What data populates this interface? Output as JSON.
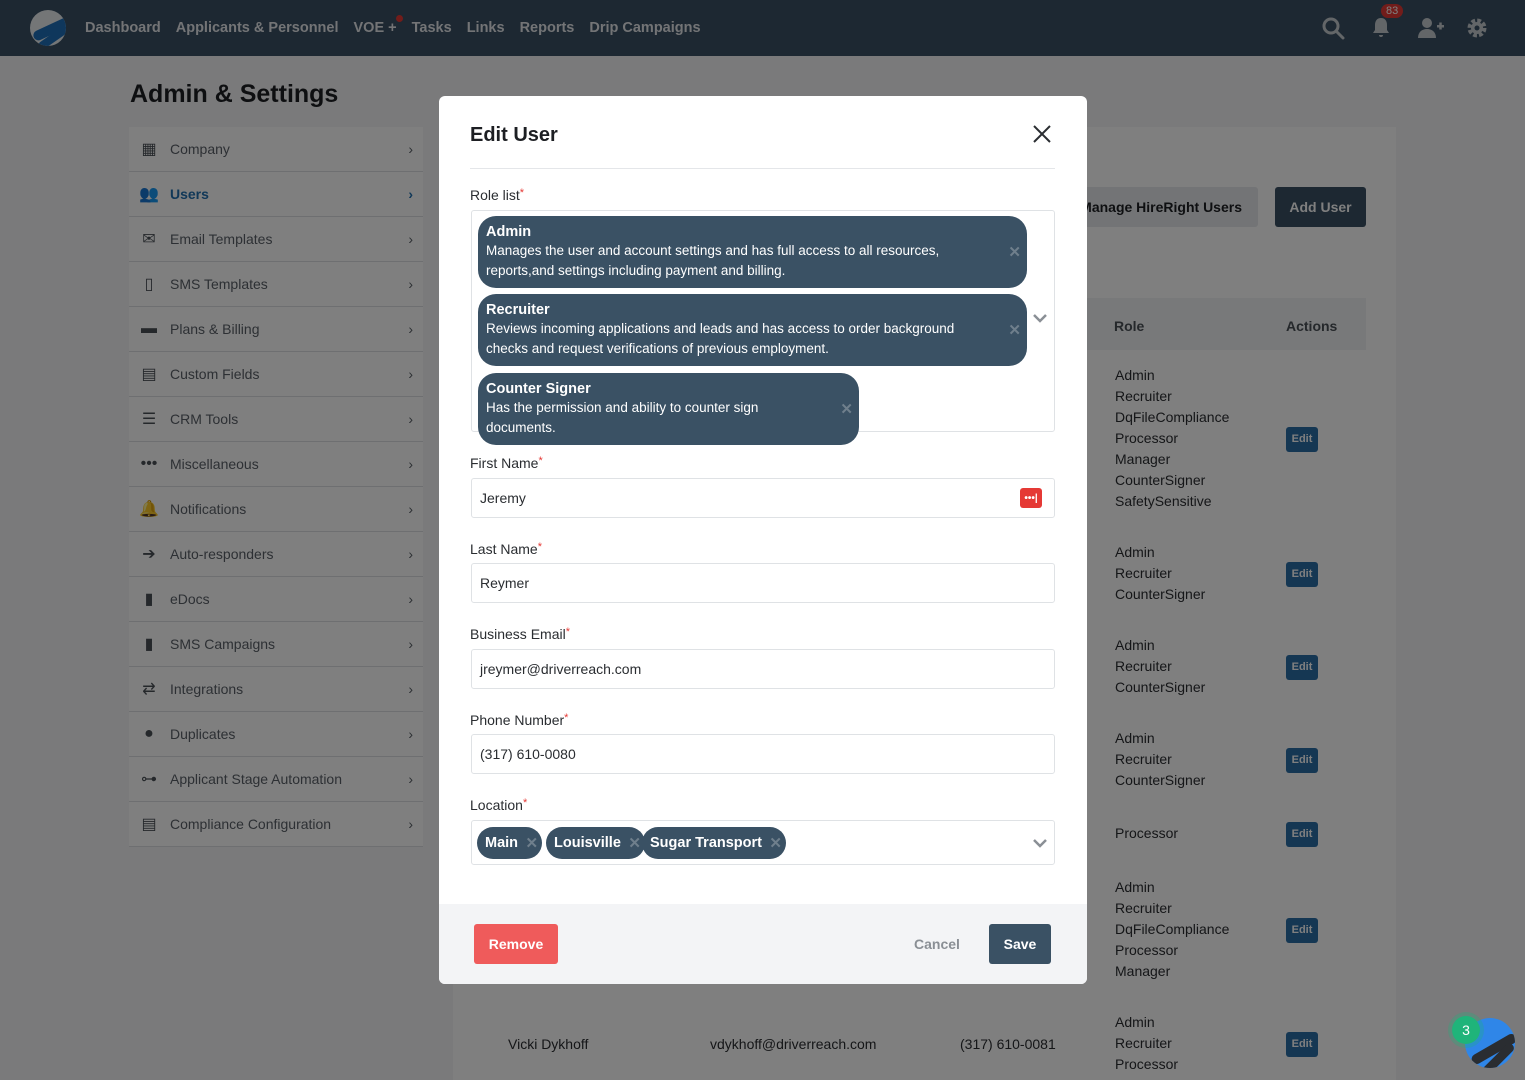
{
  "nav": {
    "links": [
      "Dashboard",
      "Applicants & Personnel",
      "VOE +",
      "Tasks",
      "Links",
      "Reports",
      "Drip Campaigns"
    ],
    "notification_count": "83",
    "icons": [
      "search-icon",
      "bell-icon",
      "add-user-icon",
      "gear-icon"
    ]
  },
  "page": {
    "title": "Admin & Settings"
  },
  "sidebar": {
    "items": [
      {
        "label": "Company",
        "icon": "building-icon",
        "glyph": "▦"
      },
      {
        "label": "Users",
        "icon": "users-icon",
        "glyph": "👥",
        "active": true
      },
      {
        "label": "Email Templates",
        "icon": "envelope-icon",
        "glyph": "✉"
      },
      {
        "label": "SMS Templates",
        "icon": "mobile-icon",
        "glyph": "▯"
      },
      {
        "label": "Plans & Billing",
        "icon": "credit-card-icon",
        "glyph": "▬"
      },
      {
        "label": "Custom Fields",
        "icon": "id-card-icon",
        "glyph": "▤"
      },
      {
        "label": "CRM Tools",
        "icon": "server-icon",
        "glyph": "☰"
      },
      {
        "label": "Miscellaneous",
        "icon": "ellipsis-icon",
        "glyph": "•••"
      },
      {
        "label": "Notifications",
        "icon": "bell-icon",
        "glyph": "🔔"
      },
      {
        "label": "Auto-responders",
        "icon": "arrow-circle-right-icon",
        "glyph": "➔"
      },
      {
        "label": "eDocs",
        "icon": "file-icon",
        "glyph": "▮"
      },
      {
        "label": "SMS Campaigns",
        "icon": "mobile-solid-icon",
        "glyph": "▮"
      },
      {
        "label": "Integrations",
        "icon": "exchange-icon",
        "glyph": "⇄"
      },
      {
        "label": "Duplicates",
        "icon": "user-icon",
        "glyph": "●"
      },
      {
        "label": "Applicant Stage Automation",
        "icon": "sitemap-icon",
        "glyph": "⊶"
      },
      {
        "label": "Compliance Configuration",
        "icon": "clipboard-list-icon",
        "glyph": "▤"
      }
    ]
  },
  "content": {
    "manage_hireright_label": "Manage HireRight Users",
    "add_user_label": "Add User",
    "columns": {
      "role": "Role",
      "actions": "Actions"
    },
    "edit_label": "Edit",
    "rows": [
      {
        "roles": [
          "Admin",
          "Recruiter",
          "DqFileCompliance",
          "Processor",
          "Manager",
          "CounterSigner",
          "SafetySensitive"
        ]
      },
      {
        "roles": [
          "Admin",
          "Recruiter",
          "CounterSigner"
        ]
      },
      {
        "roles": [
          "Admin",
          "Recruiter",
          "CounterSigner"
        ]
      },
      {
        "roles": [
          "Admin",
          "Recruiter",
          "CounterSigner"
        ]
      },
      {
        "roles": [
          "Processor"
        ]
      },
      {
        "roles": [
          "Admin",
          "Recruiter",
          "DqFileCompliance",
          "Processor",
          "Manager"
        ]
      },
      {
        "name": "Vicki Dykhoff",
        "email": "vdykhoff@driverreach.com",
        "phone": "(317) 610-0081",
        "roles": [
          "Admin",
          "Recruiter",
          "Processor"
        ]
      }
    ]
  },
  "modal": {
    "title": "Edit User",
    "role_list_label": "Role list",
    "roles": [
      {
        "name": "Admin",
        "description": "Manages the user and account settings and has full access to all resources, reports,and settings including payment and billing."
      },
      {
        "name": "Recruiter",
        "description": "Reviews incoming applications and leads and has access to order background checks and request verifications of previous employment."
      },
      {
        "name": "Counter Signer",
        "description": "Has the permission and ability to counter sign documents."
      }
    ],
    "first_name_label": "First Name",
    "first_name_value": "Jeremy",
    "last_name_label": "Last Name",
    "last_name_value": "Reymer",
    "email_label": "Business Email",
    "email_value": "jreymer@driverreach.com",
    "phone_label": "Phone Number",
    "phone_value": "(317) 610-0080",
    "location_label": "Location",
    "locations": [
      "Main",
      "Louisville",
      "Sugar Transport"
    ],
    "required_mark": "*",
    "remove_label": "Remove",
    "cancel_label": "Cancel",
    "save_label": "Save"
  },
  "chat": {
    "unread_count": "3"
  },
  "colors": {
    "brand": "#3a5164",
    "accent": "#2271b1",
    "danger": "#ef5b5b",
    "success": "#1fb47a"
  }
}
